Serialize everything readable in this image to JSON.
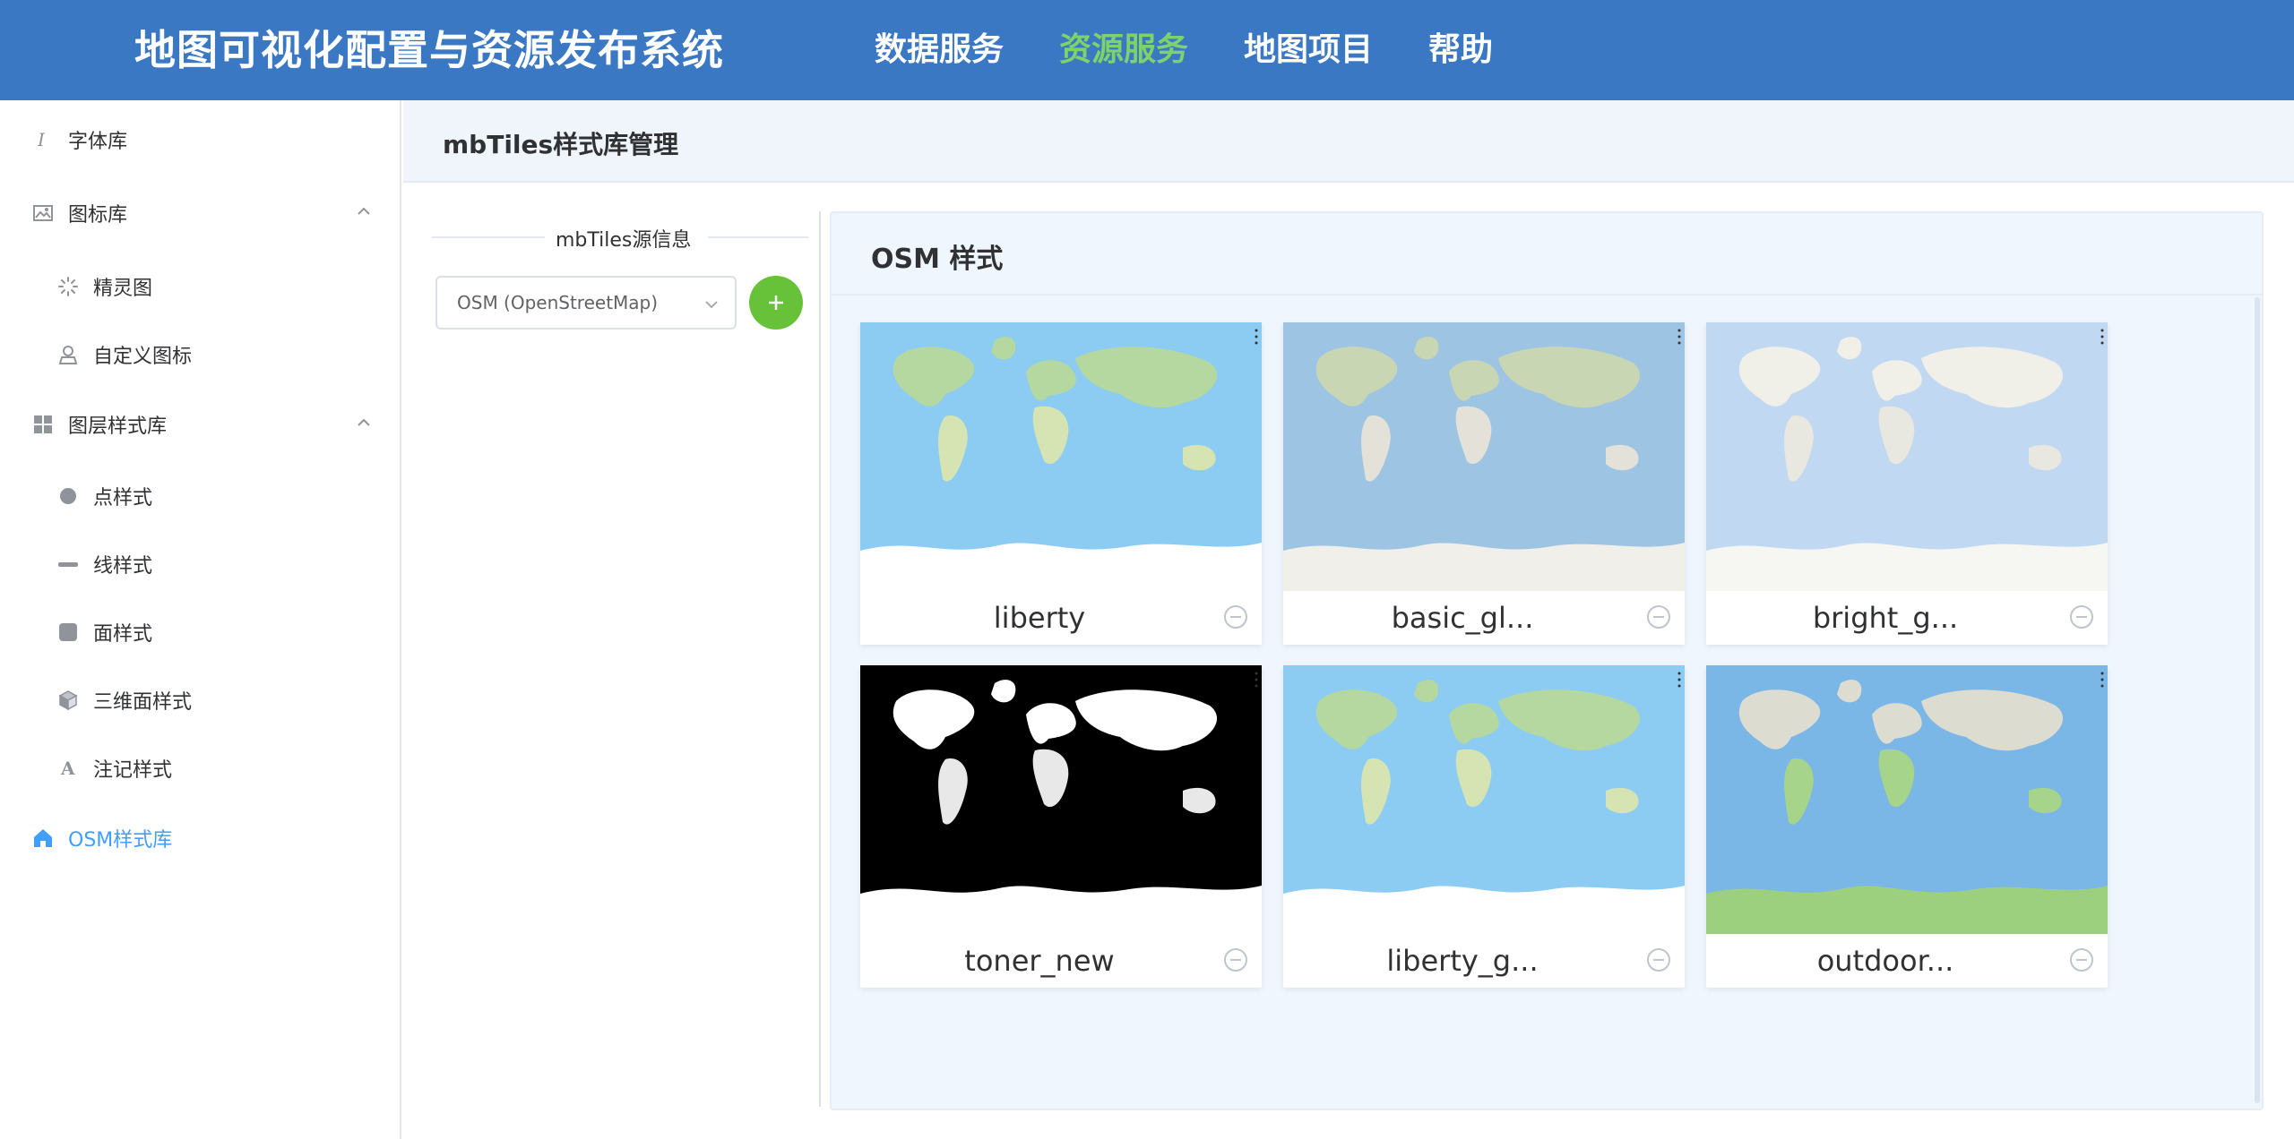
{
  "header": {
    "app_title": "地图可视化配置与资源发布系统",
    "nav": [
      {
        "label": "数据服务",
        "active": false
      },
      {
        "label": "资源服务",
        "active": true
      },
      {
        "label": "地图项目",
        "active": false
      },
      {
        "label": "帮助",
        "active": false
      }
    ],
    "accent_color": "#3b78c4",
    "active_color": "#7ed26c"
  },
  "sidebar": {
    "items": [
      {
        "label": "字体库",
        "icon": "font-icon",
        "level": 1
      },
      {
        "label": "图标库",
        "icon": "image-icon",
        "level": 1,
        "expanded": true
      },
      {
        "label": "精灵图",
        "icon": "spinner-icon",
        "level": 2
      },
      {
        "label": "自定义图标",
        "icon": "user-icon",
        "level": 2
      },
      {
        "label": "图层样式库",
        "icon": "grid-icon",
        "level": 1,
        "expanded": true
      },
      {
        "label": "点样式",
        "icon": "point-icon",
        "level": 2
      },
      {
        "label": "线样式",
        "icon": "line-icon",
        "level": 2
      },
      {
        "label": "面样式",
        "icon": "polygon-icon",
        "level": 2
      },
      {
        "label": "三维面样式",
        "icon": "cube-icon",
        "level": 2
      },
      {
        "label": "注记样式",
        "icon": "text-icon",
        "level": 2
      },
      {
        "label": "OSM样式库",
        "icon": "home-icon",
        "level": 1,
        "active": true
      }
    ],
    "active_color": "#409eff"
  },
  "main": {
    "page_title": "mbTiles样式库管理",
    "source": {
      "divider_label": "mbTiles源信息",
      "selected": "OSM (OpenStreetMap)",
      "add_label": "+"
    },
    "styles_panel": {
      "title": "OSM 样式",
      "cards": [
        {
          "name": "liberty",
          "theme": "liberty"
        },
        {
          "name": "basic_gl...",
          "theme": "basic"
        },
        {
          "name": "bright_g...",
          "theme": "bright"
        },
        {
          "name": "toner_new",
          "theme": "toner"
        },
        {
          "name": "liberty_g...",
          "theme": "liberty"
        },
        {
          "name": "outdoor...",
          "theme": "outdoor"
        }
      ]
    }
  }
}
